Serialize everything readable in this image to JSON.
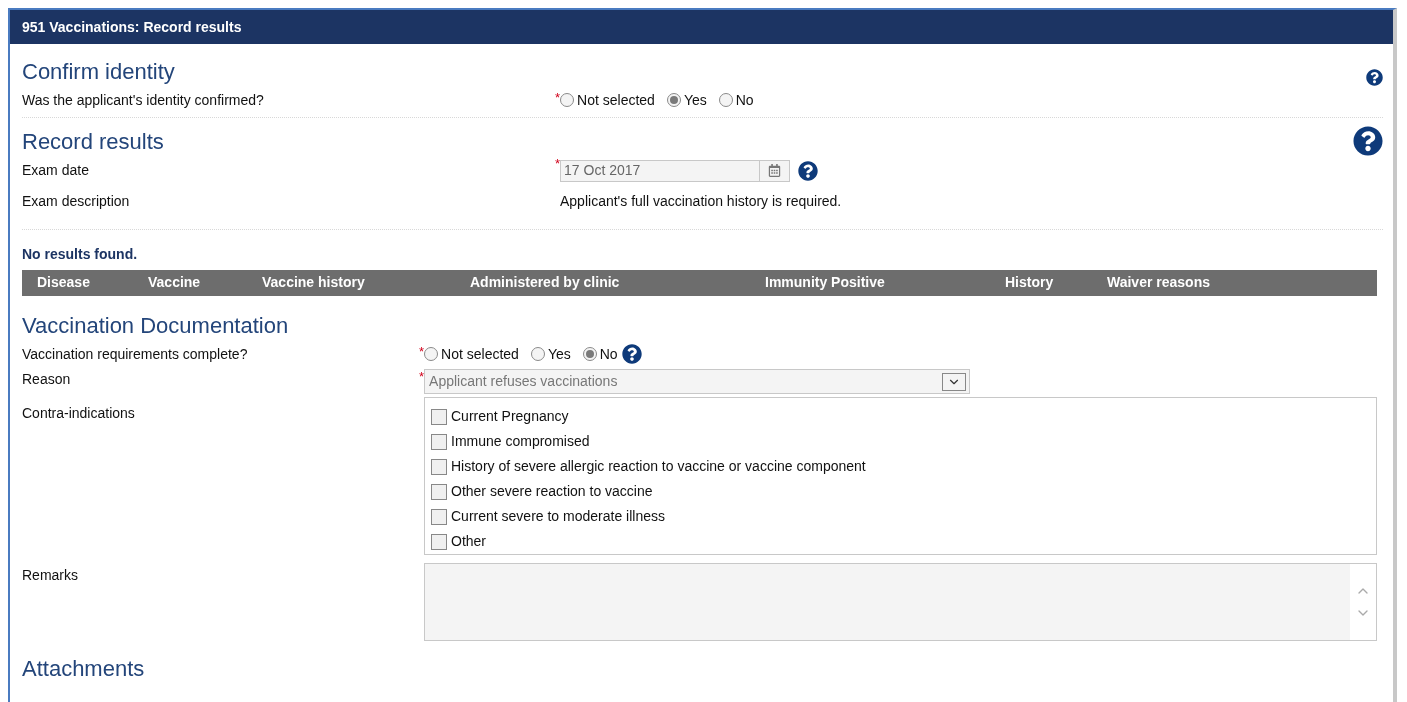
{
  "window": {
    "title": "951 Vaccinations: Record results"
  },
  "confirm_identity": {
    "heading": "Confirm identity",
    "question": {
      "label": "Was the applicant's identity confirmed?",
      "required_mark": "*",
      "options": [
        {
          "label": "Not selected",
          "selected": false
        },
        {
          "label": "Yes",
          "selected": true
        },
        {
          "label": "No",
          "selected": false
        }
      ]
    }
  },
  "record_results": {
    "heading": "Record results",
    "exam_date": {
      "label": "Exam date",
      "required_mark": "*",
      "value": "17 Oct 2017"
    },
    "exam_description": {
      "label": "Exam description",
      "value": "Applicant's full vaccination history is required."
    },
    "status": "No results found.",
    "table": {
      "columns": [
        "Disease",
        "Vaccine",
        "Vaccine history",
        "Administered by clinic",
        "Immunity Positive",
        "History",
        "Waiver reasons"
      ]
    }
  },
  "vaccination_documentation": {
    "heading": "Vaccination Documentation",
    "requirements": {
      "label": "Vaccination requirements complete?",
      "required_mark": "*",
      "options": [
        {
          "label": "Not selected",
          "selected": false
        },
        {
          "label": "Yes",
          "selected": false
        },
        {
          "label": "No",
          "selected": true
        }
      ]
    },
    "reason": {
      "label": "Reason",
      "required_mark": "*",
      "value": "Applicant refuses vaccinations"
    },
    "contra_indications": {
      "label": "Contra-indications",
      "items": [
        {
          "label": "Current Pregnancy",
          "checked": false
        },
        {
          "label": "Immune compromised",
          "checked": false
        },
        {
          "label": "History of severe allergic reaction to vaccine or vaccine component",
          "checked": false
        },
        {
          "label": "Other severe reaction to vaccine",
          "checked": false
        },
        {
          "label": "Current severe to moderate illness",
          "checked": false
        },
        {
          "label": "Other",
          "checked": false
        }
      ]
    },
    "remarks": {
      "label": "Remarks"
    }
  },
  "attachments": {
    "heading": "Attachments"
  }
}
